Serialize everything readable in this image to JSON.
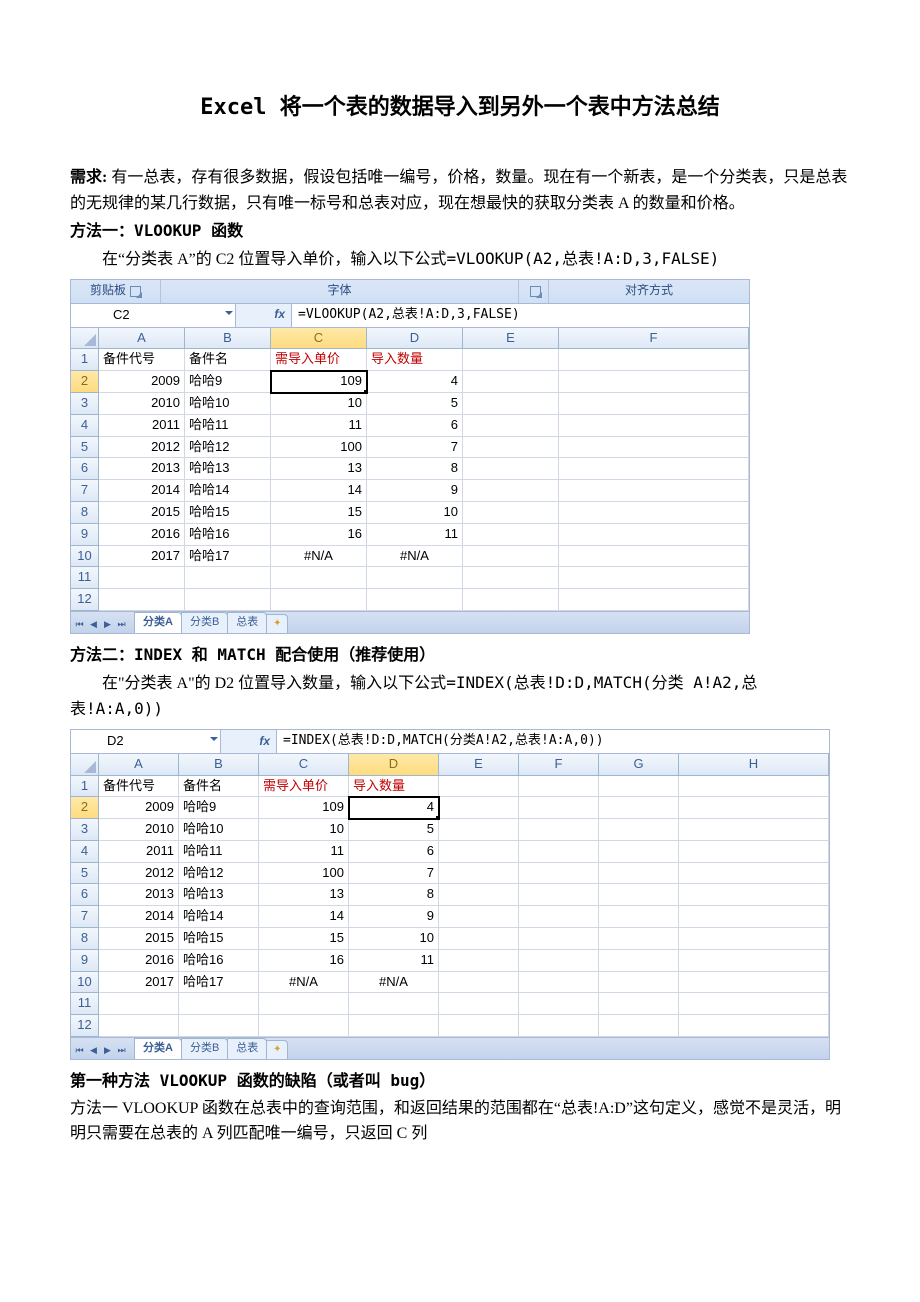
{
  "title": "Excel 将一个表的数据导入到另外一个表中方法总结",
  "intro": {
    "label": "需求:",
    "text": "有一总表，存有很多数据，假设包括唯一编号，价格，数量。现在有一个新表，是一个分类表，只是总表的无规律的某几行数据，只有唯一标号和总表对应，现在想最快的获取分类表 A 的数量和价格。"
  },
  "method1": {
    "heading": "方法一：VLOOKUP 函数",
    "desc_prefix": "在“分类表 A”的 C2 位置导入单价，输入以下公式",
    "formula_text": "=VLOOKUP(A2,总表!A:D,3,FALSE)"
  },
  "fig1": {
    "ribbon": {
      "clipboard": "剪贴板",
      "font": "字体",
      "align": "对齐方式"
    },
    "namebox": "C2",
    "formula": "=VLOOKUP(A2,总表!A:D,3,FALSE)",
    "cols": [
      "A",
      "B",
      "C",
      "D",
      "E",
      "F"
    ],
    "headers": {
      "A": "备件代号",
      "B": "备件名",
      "C": "需导入单价",
      "D": "导入数量"
    },
    "rows": [
      {
        "r": 1
      },
      {
        "r": 2,
        "A": "2009",
        "B": "哈哈9",
        "C": "109",
        "D": "4"
      },
      {
        "r": 3,
        "A": "2010",
        "B": "哈哈10",
        "C": "10",
        "D": "5"
      },
      {
        "r": 4,
        "A": "2011",
        "B": "哈哈11",
        "C": "11",
        "D": "6"
      },
      {
        "r": 5,
        "A": "2012",
        "B": "哈哈12",
        "C": "100",
        "D": "7"
      },
      {
        "r": 6,
        "A": "2013",
        "B": "哈哈13",
        "C": "13",
        "D": "8"
      },
      {
        "r": 7,
        "A": "2014",
        "B": "哈哈14",
        "C": "14",
        "D": "9"
      },
      {
        "r": 8,
        "A": "2015",
        "B": "哈哈15",
        "C": "15",
        "D": "10"
      },
      {
        "r": 9,
        "A": "2016",
        "B": "哈哈16",
        "C": "16",
        "D": "11"
      },
      {
        "r": 10,
        "A": "2017",
        "B": "哈哈17",
        "C": "#N/A",
        "D": "#N/A"
      },
      {
        "r": 11
      },
      {
        "r": 12
      }
    ],
    "tabs": [
      "分类A",
      "分类B",
      "总表"
    ]
  },
  "method2": {
    "heading": "方法二：INDEX 和 MATCH 配合使用（推荐使用）",
    "desc_prefix": "在\"分类表 A\"的 D2 位置导入数量，输入以下公式",
    "formula_text": "=INDEX(总表!D:D,MATCH(分类 A!A2,总表!A:A,0))"
  },
  "fig2": {
    "namebox": "D2",
    "formula": "=INDEX(总表!D:D,MATCH(分类A!A2,总表!A:A,0))",
    "cols": [
      "A",
      "B",
      "C",
      "D",
      "E",
      "F",
      "G",
      "H"
    ],
    "headers": {
      "A": "备件代号",
      "B": "备件名",
      "C": "需导入单价",
      "D": "导入数量"
    },
    "rows": [
      {
        "r": 1
      },
      {
        "r": 2,
        "A": "2009",
        "B": "哈哈9",
        "C": "109",
        "D": "4"
      },
      {
        "r": 3,
        "A": "2010",
        "B": "哈哈10",
        "C": "10",
        "D": "5"
      },
      {
        "r": 4,
        "A": "2011",
        "B": "哈哈11",
        "C": "11",
        "D": "6"
      },
      {
        "r": 5,
        "A": "2012",
        "B": "哈哈12",
        "C": "100",
        "D": "7"
      },
      {
        "r": 6,
        "A": "2013",
        "B": "哈哈13",
        "C": "13",
        "D": "8"
      },
      {
        "r": 7,
        "A": "2014",
        "B": "哈哈14",
        "C": "14",
        "D": "9"
      },
      {
        "r": 8,
        "A": "2015",
        "B": "哈哈15",
        "C": "15",
        "D": "10"
      },
      {
        "r": 9,
        "A": "2016",
        "B": "哈哈16",
        "C": "16",
        "D": "11"
      },
      {
        "r": 10,
        "A": "2017",
        "B": "哈哈17",
        "C": "#N/A",
        "D": "#N/A"
      },
      {
        "r": 11
      },
      {
        "r": 12
      }
    ],
    "tabs": [
      "分类A",
      "分类B",
      "总表"
    ]
  },
  "drawback": {
    "heading": "第一种方法 VLOOKUP 函数的缺陷（或者叫 bug）",
    "p1": "方法一 VLOOKUP 函数在总表中的查询范围，和返回结果的范围都在“总表!A:D”这句定义，感觉不是灵活，明明只需要在总表的 A 列匹配唯一编号，只返回 C 列"
  }
}
